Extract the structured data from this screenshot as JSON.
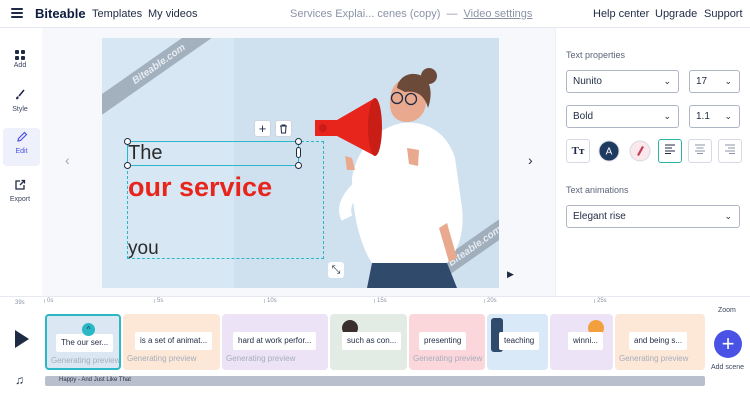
{
  "header": {
    "brand": "Biteable",
    "nav": [
      "Templates",
      "My videos"
    ],
    "project_title": "Services Explai... cenes (copy)",
    "separator": "—",
    "video_settings": "Video settings",
    "right_links": [
      "Help center",
      "Upgrade",
      "Support"
    ]
  },
  "sidebar": {
    "items": [
      {
        "label": "Add",
        "icon": "grid-icon"
      },
      {
        "label": "Style",
        "icon": "brush-icon"
      },
      {
        "label": "Edit",
        "icon": "pencil-icon"
      },
      {
        "label": "Export",
        "icon": "export-icon"
      }
    ]
  },
  "canvas": {
    "watermark": "Biteable.com",
    "text_lines": [
      "The",
      "our service",
      "you"
    ],
    "text_color_primary": "#2a2a2a",
    "text_color_accent": "#e8251c",
    "background": "#cfe1ef"
  },
  "text_properties": {
    "title": "Text properties",
    "font": "Nunito",
    "size": "17",
    "weight": "Bold",
    "line_height": "1.1",
    "format_buttons": [
      "text-style-icon",
      "font-color-icon",
      "highlight-color-icon",
      "align-left-icon",
      "align-center-icon",
      "align-right-icon"
    ],
    "text_color_swatch_letter": "A",
    "font_color": "#1f3a5f",
    "highlight_color": "#f2b8c2",
    "selected_alignment": "align-left"
  },
  "text_animations": {
    "title": "Text animations",
    "value": "Elegant rise"
  },
  "timeline": {
    "duration": "39s",
    "ticks": [
      "0s",
      "5s",
      "10s",
      "15s",
      "20s",
      "25s"
    ],
    "scenes": [
      {
        "label": "The our ser...",
        "status": "Generating preview",
        "active": true
      },
      {
        "label": "is a set of animat...",
        "status": "Generating preview"
      },
      {
        "label": "hard at work perfor...",
        "status": "Generating preview"
      },
      {
        "label": "such as con...",
        "status": ""
      },
      {
        "label": "presenting",
        "status": "Generating preview"
      },
      {
        "label": "teaching",
        "status": ""
      },
      {
        "label": "winni...",
        "status": ""
      },
      {
        "label": "and being s...",
        "status": "Generating preview"
      }
    ],
    "audio_track": "Happy - And Just Like That",
    "zoom_label": "Zoom",
    "add_scene_label": "Add scene"
  },
  "colors": {
    "accent": "#4a52e6",
    "selection": "#2bb8c5",
    "dark": "#1f2a44"
  }
}
